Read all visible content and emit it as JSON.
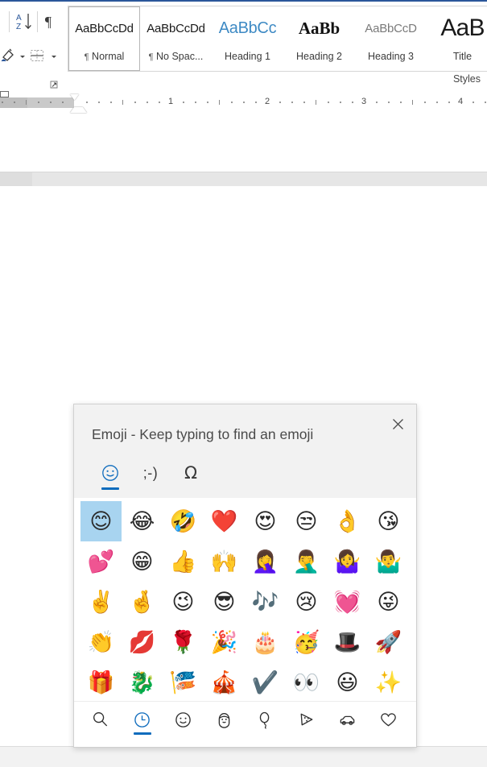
{
  "ribbon": {
    "group_label": "Styles",
    "tools": [
      {
        "name": "sort-button",
        "label": "A↓Z"
      },
      {
        "name": "show-formatting-marks-button",
        "label": "¶"
      },
      {
        "name": "shading-button",
        "label": "shading"
      },
      {
        "name": "borders-button",
        "label": "borders"
      }
    ],
    "styles": [
      {
        "preview": "AaBbCcDd",
        "name": "Normal",
        "pilcrow": "¶",
        "selected": true,
        "class": "p-normal"
      },
      {
        "preview": "AaBbCcDd",
        "name": "No Spac...",
        "pilcrow": "¶",
        "selected": false,
        "class": "p-nospace"
      },
      {
        "preview": "AaBbCс",
        "name": "Heading 1",
        "pilcrow": "",
        "selected": false,
        "class": "p-h1"
      },
      {
        "preview": "AaBb",
        "name": "Heading 2",
        "pilcrow": "",
        "selected": false,
        "class": "p-h2"
      },
      {
        "preview": "AaBbCcD",
        "name": "Heading 3",
        "pilcrow": "",
        "selected": false,
        "class": "p-h3"
      },
      {
        "preview": "AaB",
        "name": "Title",
        "pilcrow": "",
        "selected": false,
        "class": "p-title"
      }
    ]
  },
  "ruler": {
    "numbers": [
      "1",
      "2",
      "3",
      "4"
    ]
  },
  "emoji_panel": {
    "title": "Emoji - Keep typing to find an emoji",
    "close_label": "✕",
    "header_tabs": [
      {
        "name": "tab-emoji",
        "glyph": "☺",
        "kind": "smiley",
        "active": true
      },
      {
        "name": "tab-kaomoji",
        "glyph": ";-)",
        "kind": "text",
        "active": false
      },
      {
        "name": "tab-symbols",
        "glyph": "Ω",
        "kind": "omega",
        "active": false
      }
    ],
    "selected_emoji": "smiling-face-with-smiling-eyes",
    "rows": [
      [
        {
          "glyph": "😊",
          "name": "smiling-face-with-smiling-eyes",
          "selected": true
        },
        {
          "glyph": "😂",
          "name": "face-with-tears-of-joy",
          "selected": false
        },
        {
          "glyph": "🤣",
          "name": "rolling-on-the-floor-laughing",
          "selected": false
        },
        {
          "glyph": "❤️",
          "name": "red-heart",
          "selected": false
        },
        {
          "glyph": "😍",
          "name": "smiling-face-with-heart-eyes",
          "selected": false
        },
        {
          "glyph": "😒",
          "name": "unamused-face",
          "selected": false
        },
        {
          "glyph": "👌",
          "name": "ok-hand",
          "selected": false
        },
        {
          "glyph": "😘",
          "name": "face-blowing-a-kiss",
          "selected": false
        }
      ],
      [
        {
          "glyph": "💕",
          "name": "two-hearts",
          "selected": false
        },
        {
          "glyph": "😁",
          "name": "beaming-face-with-smiling-eyes",
          "selected": false
        },
        {
          "glyph": "👍",
          "name": "thumbs-up",
          "selected": false
        },
        {
          "glyph": "🙌",
          "name": "raising-hands",
          "selected": false
        },
        {
          "glyph": "🤦‍♀️",
          "name": "woman-facepalming",
          "selected": false
        },
        {
          "glyph": "🤦‍♂️",
          "name": "man-facepalming",
          "selected": false
        },
        {
          "glyph": "🤷‍♀️",
          "name": "woman-shrugging",
          "selected": false
        },
        {
          "glyph": "🤷‍♂️",
          "name": "man-shrugging",
          "selected": false
        }
      ],
      [
        {
          "glyph": "✌️",
          "name": "victory-hand",
          "selected": false
        },
        {
          "glyph": "🤞",
          "name": "crossed-fingers",
          "selected": false
        },
        {
          "glyph": "😉",
          "name": "winking-face",
          "selected": false
        },
        {
          "glyph": "😎",
          "name": "smiling-face-with-sunglasses",
          "selected": false
        },
        {
          "glyph": "🎶",
          "name": "musical-notes",
          "selected": false
        },
        {
          "glyph": "😢",
          "name": "crying-face",
          "selected": false
        },
        {
          "glyph": "💓",
          "name": "beating-heart",
          "selected": false
        },
        {
          "glyph": "😜",
          "name": "winking-face-with-tongue",
          "selected": false
        }
      ],
      [
        {
          "glyph": "👏",
          "name": "clapping-hands",
          "selected": false
        },
        {
          "glyph": "💋",
          "name": "kiss-mark",
          "selected": false
        },
        {
          "glyph": "🌹",
          "name": "rose",
          "selected": false
        },
        {
          "glyph": "🎉",
          "name": "party-popper",
          "selected": false
        },
        {
          "glyph": "🎂",
          "name": "birthday-cake",
          "selected": false
        },
        {
          "glyph": "🥳",
          "name": "party-horn",
          "selected": false
        },
        {
          "glyph": "🎩",
          "name": "top-hat",
          "selected": false
        },
        {
          "glyph": "🚀",
          "name": "rocket",
          "selected": false
        }
      ],
      [
        {
          "glyph": "🎁",
          "name": "wrapped-gift",
          "selected": false
        },
        {
          "glyph": "🐉",
          "name": "dragon",
          "selected": false
        },
        {
          "glyph": "🎏",
          "name": "carp-streamer",
          "selected": false
        },
        {
          "glyph": "🎪",
          "name": "circus-tent",
          "selected": false
        },
        {
          "glyph": "✔️",
          "name": "check-mark",
          "selected": false
        },
        {
          "glyph": "👀",
          "name": "eyes",
          "selected": false
        },
        {
          "glyph": "😃",
          "name": "grinning-face-with-big-eyes",
          "selected": false
        },
        {
          "glyph": "✨",
          "name": "sparkles",
          "selected": false
        }
      ]
    ],
    "categories": [
      {
        "name": "category-search",
        "icon": "search-icon",
        "active": false
      },
      {
        "name": "category-recent",
        "icon": "clock-icon",
        "active": true
      },
      {
        "name": "category-smileys",
        "icon": "smiley-icon",
        "active": false
      },
      {
        "name": "category-people",
        "icon": "person-icon",
        "active": false
      },
      {
        "name": "category-celebration",
        "icon": "balloon-icon",
        "active": false
      },
      {
        "name": "category-food",
        "icon": "pizza-icon",
        "active": false
      },
      {
        "name": "category-travel",
        "icon": "car-icon",
        "active": false
      },
      {
        "name": "category-symbols",
        "icon": "heart-icon",
        "active": false
      }
    ]
  },
  "colors": {
    "accent": "#0f6cbd",
    "selection": "#a8d4f0",
    "ribbon_top": "#2b579a",
    "panel_header_bg": "#f2f2f2"
  }
}
